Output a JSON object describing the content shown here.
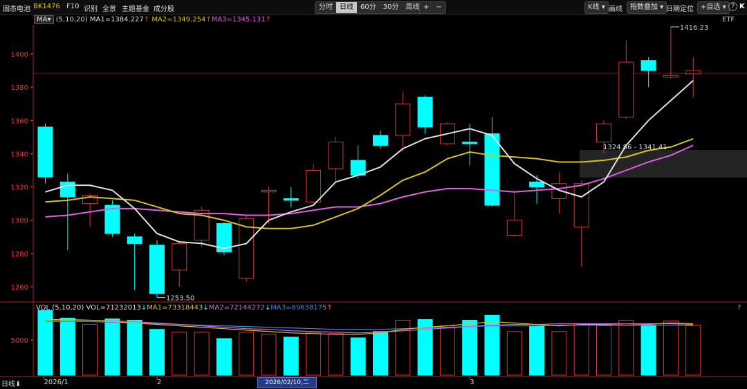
{
  "toolbar": {
    "name": "固态电池",
    "code": "BK1476",
    "f10": "F10",
    "identify": "识别",
    "scene": "全景",
    "theme_fund": "主题基金",
    "constituents": "成分股",
    "periods": [
      "分时",
      "日线",
      "60分",
      "30分",
      "周线"
    ],
    "active_period": "日线",
    "plus": "+",
    "minus": "−",
    "kline": "K线",
    "draw": "画线",
    "index_overlay": "指数叠加",
    "date_locate": "日期定位",
    "add_watch": "+自选",
    "help": "?",
    "k": "K"
  },
  "legend": {
    "ma_tag": "MA",
    "params": "(5,10,20)",
    "ma1": "MA1=1384.227",
    "ma2": "MA2=1349.254",
    "ma3": "MA3=1345.131",
    "ma1_arrow": "↑",
    "ma2_arrow": "↑",
    "ma3_arrow": "↑"
  },
  "vol_legend": {
    "label": "VOL",
    "params": "(5,10,20)",
    "vol": "VOL=71232013",
    "vol_arrow": "↓",
    "ma1": "MA1=73318443",
    "ma1_arrow": "↓",
    "ma2": "MA2=72144272",
    "ma2_arrow": "↓",
    "ma3": "MA3=69638175",
    "ma3_arrow": "↑"
  },
  "etf": "ETF",
  "chart_data": {
    "type": "candlestick",
    "price_axis": {
      "min": 1250,
      "max": 1412,
      "ticks": [
        1260,
        1280,
        1300,
        1320,
        1340,
        1360,
        1380,
        1400
      ]
    },
    "candles": [
      {
        "open": 1356,
        "close": 1326,
        "high": 1358,
        "low": 1322,
        "up": false
      },
      {
        "open": 1323,
        "close": 1314,
        "high": 1328,
        "low": 1282,
        "up": false
      },
      {
        "open": 1310,
        "close": 1315,
        "high": 1316,
        "low": 1296,
        "up": true
      },
      {
        "open": 1309,
        "close": 1292,
        "high": 1312,
        "low": 1290,
        "up": false
      },
      {
        "open": 1290,
        "close": 1286,
        "high": 1292,
        "low": 1258,
        "up": false
      },
      {
        "open": 1285,
        "close": 1256,
        "high": 1288,
        "low": 1253.5,
        "up": false
      },
      {
        "open": 1270,
        "close": 1286,
        "high": 1287,
        "low": 1260,
        "up": true
      },
      {
        "open": 1288,
        "close": 1306,
        "high": 1308,
        "low": 1284,
        "up": true
      },
      {
        "open": 1298,
        "close": 1281,
        "high": 1299,
        "low": 1279,
        "up": false
      },
      {
        "open": 1265,
        "close": 1301,
        "high": 1303,
        "low": 1263,
        "up": true
      },
      {
        "open": 1317,
        "close": 1318,
        "high": 1320,
        "low": 1298,
        "up": true
      },
      {
        "open": 1313,
        "close": 1312,
        "high": 1320,
        "low": 1308,
        "up": false
      },
      {
        "open": 1311,
        "close": 1330,
        "high": 1334,
        "low": 1309,
        "up": true
      },
      {
        "open": 1331,
        "close": 1347,
        "high": 1350,
        "low": 1323,
        "up": true
      },
      {
        "open": 1336,
        "close": 1327,
        "high": 1345,
        "low": 1325,
        "up": false
      },
      {
        "open": 1351,
        "close": 1345,
        "high": 1354,
        "low": 1343,
        "up": false
      },
      {
        "open": 1351,
        "close": 1370,
        "high": 1377,
        "low": 1341,
        "up": true
      },
      {
        "open": 1374,
        "close": 1356,
        "high": 1375,
        "low": 1352,
        "up": false
      },
      {
        "open": 1346,
        "close": 1358,
        "high": 1359,
        "low": 1345,
        "up": true
      },
      {
        "open": 1347,
        "close": 1346,
        "high": 1358,
        "low": 1333,
        "up": false
      },
      {
        "open": 1352,
        "close": 1309,
        "high": 1362,
        "low": 1308,
        "up": false
      },
      {
        "open": 1291,
        "close": 1300,
        "high": 1316,
        "low": 1290,
        "up": true
      },
      {
        "open": 1323,
        "close": 1320,
        "high": 1327,
        "low": 1310,
        "up": false
      },
      {
        "open": 1313,
        "close": 1322,
        "high": 1329,
        "low": 1304,
        "up": true
      },
      {
        "open": 1296,
        "close": 1322,
        "high": 1324,
        "low": 1272,
        "up": true
      },
      {
        "open": 1347,
        "close": 1358,
        "high": 1360,
        "low": 1340,
        "up": true
      },
      {
        "open": 1362,
        "close": 1395,
        "high": 1408,
        "low": 1361,
        "up": true
      },
      {
        "open": 1396,
        "close": 1390,
        "high": 1398,
        "low": 1380,
        "up": false
      },
      {
        "open": 1386,
        "close": 1387,
        "high": 1416.23,
        "low": 1385,
        "up": true
      },
      {
        "open": 1388,
        "close": 1390,
        "high": 1398,
        "low": 1374,
        "up": true
      }
    ],
    "ma1": [
      1317,
      1321,
      1321,
      1318,
      1307,
      1292,
      1287,
      1286,
      1283,
      1286,
      1300,
      1305,
      1309,
      1323,
      1327,
      1332,
      1343,
      1349,
      1352,
      1355,
      1351,
      1334,
      1325,
      1318,
      1314,
      1323,
      1345,
      1360,
      1372,
      1384
    ],
    "ma2": [
      1311,
      1312,
      1314,
      1313,
      1312,
      1308,
      1304,
      1303,
      1300,
      1296,
      1295,
      1295,
      1297,
      1302,
      1307,
      1315,
      1324,
      1329,
      1337,
      1341,
      1339,
      1338,
      1337,
      1335,
      1335,
      1336,
      1338,
      1342,
      1344,
      1349
    ],
    "ma3": [
      1302,
      1303,
      1305,
      1307,
      1307,
      1306,
      1305,
      1304,
      1304,
      1303,
      1303,
      1304,
      1306,
      1308,
      1308,
      1310,
      1314,
      1317,
      1319,
      1319,
      1318,
      1317,
      1318,
      1319,
      1321,
      1325,
      1330,
      1335,
      1339,
      1345
    ],
    "labels": {
      "low": "1253.50",
      "high": "1416.23",
      "range": "1324.86 - 1341.41"
    },
    "volume": {
      "values": [
        9.2,
        8.1,
        7.2,
        8.0,
        7.8,
        6.5,
        6.1,
        6.1,
        5.2,
        6.1,
        5.8,
        5.4,
        6.0,
        5.9,
        5.3,
        6.2,
        7.8,
        7.9,
        7.0,
        7.8,
        8.5,
        6.2,
        7.0,
        6.2,
        7.1,
        7.0,
        7.8,
        7.0,
        7.7,
        7.1
      ],
      "tick_label": "5000",
      "ma1": [
        7.9,
        7.9,
        7.8,
        7.6,
        7.4,
        7.2,
        7.0,
        6.8,
        6.6,
        6.4,
        6.2,
        6.0,
        5.9,
        5.8,
        5.8,
        6.0,
        6.5,
        6.8,
        7.0,
        7.3,
        7.6,
        7.4,
        7.2,
        7.0,
        7.2,
        7.2,
        7.1,
        7.2,
        7.4,
        7.3
      ],
      "ma2": [
        7.8,
        7.8,
        7.8,
        7.7,
        7.6,
        7.4,
        7.2,
        7.0,
        6.8,
        6.6,
        6.5,
        6.3,
        6.2,
        6.1,
        6.0,
        6.1,
        6.3,
        6.5,
        6.7,
        6.9,
        7.1,
        7.2,
        7.2,
        7.3,
        7.3,
        7.3,
        7.3,
        7.3,
        7.3,
        7.2
      ],
      "ma3": [
        7.6,
        7.6,
        7.6,
        7.5,
        7.4,
        7.3,
        7.2,
        7.1,
        7.0,
        6.9,
        6.8,
        6.7,
        6.6,
        6.5,
        6.5,
        6.5,
        6.6,
        6.7,
        6.8,
        6.9,
        7.0,
        7.0,
        7.0,
        7.1,
        7.1,
        7.1,
        7.1,
        7.1,
        7.1,
        7.0
      ]
    },
    "x_labels": [
      {
        "text": "2026/1",
        "index": 0
      },
      {
        "text": "2",
        "index": 5
      },
      {
        "text": "3",
        "index": 19
      }
    ],
    "bottom_left": "日线",
    "selected_date": "2026/02/10,二",
    "colors": {
      "up": "#d03a3a",
      "down": "#00ffff",
      "ma1": "#e0e0e0",
      "ma2": "#d4c41a",
      "ma3": "#e060e0",
      "axis": "#ff3a3a",
      "grid": "#3a0000"
    }
  }
}
